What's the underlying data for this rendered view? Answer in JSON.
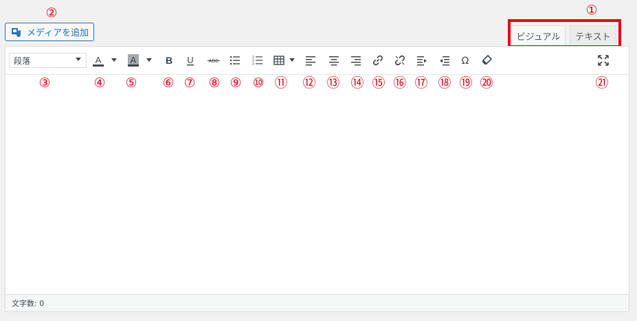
{
  "media_button": {
    "label": "メディアを追加"
  },
  "tabs": {
    "visual": "ビジュアル",
    "text": "テキスト"
  },
  "format_select": {
    "value": "段落"
  },
  "status": {
    "word_count": "文字数: 0"
  },
  "annotations": [
    "①",
    "②",
    "③",
    "④",
    "⑤",
    "⑥",
    "⑦",
    "⑧",
    "⑨",
    "⑩",
    "⑪",
    "⑫",
    "⑬",
    "⑭",
    "⑮",
    "⑯",
    "⑰",
    "⑱",
    "⑲",
    "⑳",
    "㉑"
  ],
  "colors": {
    "annotation": "#e60012",
    "accent": "#2271b1",
    "icon": "#3c434a"
  },
  "toolbar_icons": [
    "text-color-icon",
    "background-color-icon",
    "bold-icon",
    "underline-icon",
    "strikethrough-icon",
    "bullet-list-icon",
    "numbered-list-icon",
    "table-icon",
    "align-left-icon",
    "align-center-icon",
    "align-right-icon",
    "link-icon",
    "unlink-icon",
    "indent-icon",
    "outdent-icon",
    "special-character-icon",
    "clear-formatting-icon",
    "fullscreen-icon"
  ]
}
